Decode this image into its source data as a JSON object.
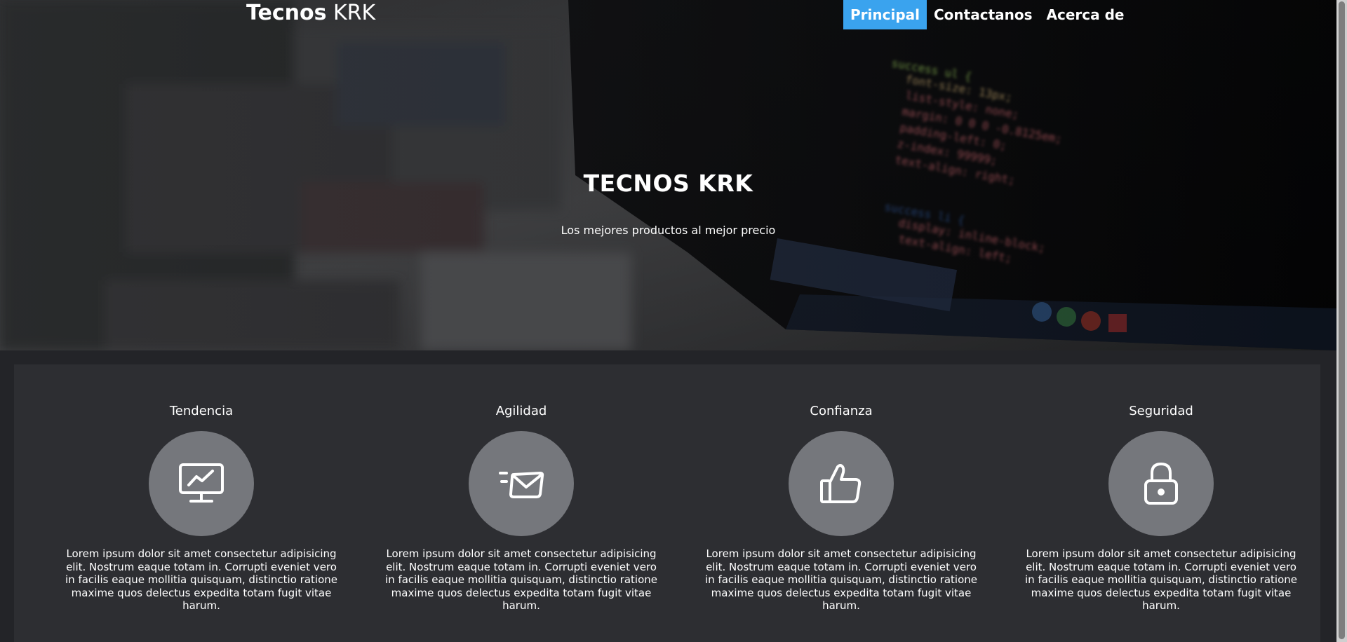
{
  "brand": {
    "bold": "Tecnos",
    "regular": "KRK"
  },
  "nav": {
    "items": [
      {
        "label": "Principal",
        "active": true
      },
      {
        "label": "Contactanos",
        "active": false
      },
      {
        "label": "Acerca de",
        "active": false
      }
    ]
  },
  "hero": {
    "title": "TECNOS KRK",
    "subtitle": "Los mejores productos al mejor precio"
  },
  "features": [
    {
      "title": "Tendencia",
      "icon": "monitor-chart-icon",
      "text": "Lorem ipsum dolor sit amet consectetur adipisicing elit. Nostrum eaque totam in. Corrupti eveniet vero in facilis eaque mollitia quisquam, distinctio ratione maxime quos delectus expedita totam fugit vitae harum."
    },
    {
      "title": "Agilidad",
      "icon": "fast-mail-icon",
      "text": "Lorem ipsum dolor sit amet consectetur adipisicing elit. Nostrum eaque totam in. Corrupti eveniet vero in facilis eaque mollitia quisquam, distinctio ratione maxime quos delectus expedita totam fugit vitae harum."
    },
    {
      "title": "Confianza",
      "icon": "thumbs-up-icon",
      "text": "Lorem ipsum dolor sit amet consectetur adipisicing elit. Nostrum eaque totam in. Corrupti eveniet vero in facilis eaque mollitia quisquam, distinctio ratione maxime quos delectus expedita totam fugit vitae harum."
    },
    {
      "title": "Seguridad",
      "icon": "lock-icon",
      "text": "Lorem ipsum dolor sit amet consectetur adipisicing elit. Nostrum eaque totam in. Corrupti eveniet vero in facilis eaque mollitia quisquam, distinctio ratione maxime quos delectus expedita totam fugit vitae harum."
    }
  ],
  "colors": {
    "nav_active": "#3aa3ee",
    "feature_circle": "#75777c",
    "features_panel": "#2d2e32"
  }
}
